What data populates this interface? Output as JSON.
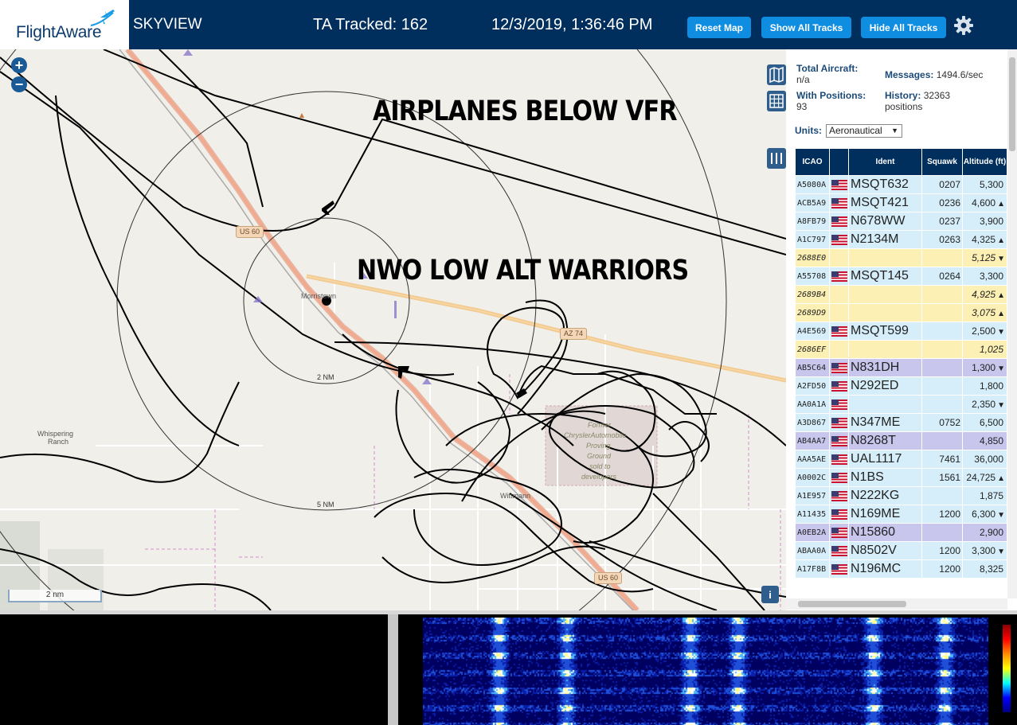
{
  "header": {
    "logo": "FlightAware",
    "app_name": "SKYVIEW",
    "tracked": "TA Tracked: 162",
    "datetime": "12/3/2019, 1:36:46 PM",
    "buttons": {
      "reset": "Reset Map",
      "show": "Show All Tracks",
      "hide": "Hide All Tracks"
    },
    "accent": "#0f8de1",
    "bar_color": "#002f5d"
  },
  "map": {
    "annotations": [
      "AIRPLANES BELOW VFR",
      "NWO LOW ALT WARRIORS"
    ],
    "labels": [
      "Morristown",
      "Wittmann",
      "Whispering",
      "Ranch",
      "Former",
      "ChryslerAutomobile",
      "Proving",
      "Ground",
      "sold to",
      "developers"
    ],
    "ring_labels": [
      "2 NM",
      "5 NM"
    ],
    "roads": [
      "US 60",
      "AZ 74",
      "US 60"
    ],
    "scale": "2 nm",
    "info": "i",
    "zoom_in": "+",
    "zoom_out": "−"
  },
  "sidebar": {
    "total_label": "Total Aircraft:",
    "total_value": "n/a",
    "positions_label": "With Positions:",
    "positions_value": "93",
    "messages_label": "Messages:",
    "messages_value": "1494.6/sec",
    "history_label": "History:",
    "history_value": "32363",
    "history_unit": "positions",
    "units_label": "Units:",
    "units_value": "Aeronautical"
  },
  "table": {
    "headers": [
      "ICAO",
      "",
      "Ident",
      "Squawk",
      "Altitude (ft)"
    ],
    "rows": [
      {
        "icao": "A5080A",
        "flag": true,
        "ident": "MSQT632",
        "squawk": "0207",
        "alt": "5,300",
        "trend": "",
        "type": ""
      },
      {
        "icao": "ACB5A9",
        "flag": true,
        "ident": "MSQT421",
        "squawk": "0236",
        "alt": "4,600",
        "trend": "▲",
        "type": ""
      },
      {
        "icao": "A8FB79",
        "flag": true,
        "ident": "N678WW",
        "squawk": "0237",
        "alt": "3,900",
        "trend": "",
        "type": ""
      },
      {
        "icao": "A1C797",
        "flag": true,
        "ident": "N2134M",
        "squawk": "0263",
        "alt": "4,325",
        "trend": "▲",
        "type": ""
      },
      {
        "icao": "2688E0",
        "flag": false,
        "ident": "",
        "squawk": "",
        "alt": "5,125",
        "trend": "▼",
        "type": "mlat"
      },
      {
        "icao": "A55708",
        "flag": true,
        "ident": "MSQT145",
        "squawk": "0264",
        "alt": "3,300",
        "trend": "",
        "type": ""
      },
      {
        "icao": "2689B4",
        "flag": false,
        "ident": "",
        "squawk": "",
        "alt": "4,925",
        "trend": "▲",
        "type": "mlat"
      },
      {
        "icao": "2689D9",
        "flag": false,
        "ident": "",
        "squawk": "",
        "alt": "3,075",
        "trend": "▲",
        "type": "mlat"
      },
      {
        "icao": "A4E569",
        "flag": true,
        "ident": "MSQT599",
        "squawk": "",
        "alt": "2,500",
        "trend": "▼",
        "type": ""
      },
      {
        "icao": "2686EF",
        "flag": false,
        "ident": "",
        "squawk": "",
        "alt": "1,025",
        "trend": "",
        "type": "mlat"
      },
      {
        "icao": "AB5C64",
        "flag": true,
        "ident": "N831DH",
        "squawk": "",
        "alt": "1,300",
        "trend": "▼",
        "type": "sel"
      },
      {
        "icao": "A2FD50",
        "flag": true,
        "ident": "N292ED",
        "squawk": "",
        "alt": "1,800",
        "trend": "",
        "type": ""
      },
      {
        "icao": "AA0A1A",
        "flag": true,
        "ident": "",
        "squawk": "",
        "alt": "2,350",
        "trend": "▼",
        "type": ""
      },
      {
        "icao": "A3D867",
        "flag": true,
        "ident": "N347ME",
        "squawk": "0752",
        "alt": "6,500",
        "trend": "",
        "type": ""
      },
      {
        "icao": "AB4AA7",
        "flag": true,
        "ident": "N8268T",
        "squawk": "",
        "alt": "4,850",
        "trend": "",
        "type": "sel"
      },
      {
        "icao": "AAA5AE",
        "flag": true,
        "ident": "UAL1117",
        "squawk": "7461",
        "alt": "36,000",
        "trend": "",
        "type": ""
      },
      {
        "icao": "A0002C",
        "flag": true,
        "ident": "N1BS",
        "squawk": "1561",
        "alt": "24,725",
        "trend": "▲",
        "type": ""
      },
      {
        "icao": "A1E957",
        "flag": true,
        "ident": "N222KG",
        "squawk": "",
        "alt": "1,875",
        "trend": "",
        "type": ""
      },
      {
        "icao": "A11435",
        "flag": true,
        "ident": "N169ME",
        "squawk": "1200",
        "alt": "6,300",
        "trend": "▼",
        "type": ""
      },
      {
        "icao": "A0EB2A",
        "flag": true,
        "ident": "N15860",
        "squawk": "",
        "alt": "2,900",
        "trend": "",
        "type": "sel"
      },
      {
        "icao": "ABAA0A",
        "flag": true,
        "ident": "N8502V",
        "squawk": "1200",
        "alt": "3,300",
        "trend": "▼",
        "type": ""
      },
      {
        "icao": "A17F8B",
        "flag": true,
        "ident": "N196MC",
        "squawk": "1200",
        "alt": "8,325",
        "trend": "",
        "type": ""
      }
    ]
  }
}
